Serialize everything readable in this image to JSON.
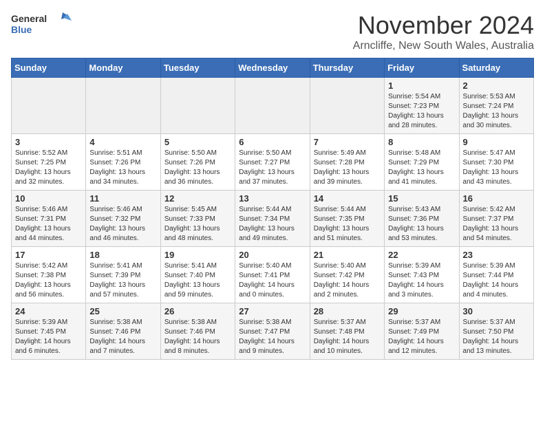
{
  "header": {
    "logo_general": "General",
    "logo_blue": "Blue",
    "month": "November 2024",
    "location": "Arncliffe, New South Wales, Australia"
  },
  "days_of_week": [
    "Sunday",
    "Monday",
    "Tuesday",
    "Wednesday",
    "Thursday",
    "Friday",
    "Saturday"
  ],
  "weeks": [
    [
      {
        "day": "",
        "empty": true
      },
      {
        "day": "",
        "empty": true
      },
      {
        "day": "",
        "empty": true
      },
      {
        "day": "",
        "empty": true
      },
      {
        "day": "",
        "empty": true
      },
      {
        "day": "1",
        "sunrise": "5:54 AM",
        "sunset": "7:23 PM",
        "daylight": "13 hours and 28 minutes."
      },
      {
        "day": "2",
        "sunrise": "5:53 AM",
        "sunset": "7:24 PM",
        "daylight": "13 hours and 30 minutes."
      }
    ],
    [
      {
        "day": "3",
        "sunrise": "5:52 AM",
        "sunset": "7:25 PM",
        "daylight": "13 hours and 32 minutes."
      },
      {
        "day": "4",
        "sunrise": "5:51 AM",
        "sunset": "7:26 PM",
        "daylight": "13 hours and 34 minutes."
      },
      {
        "day": "5",
        "sunrise": "5:50 AM",
        "sunset": "7:26 PM",
        "daylight": "13 hours and 36 minutes."
      },
      {
        "day": "6",
        "sunrise": "5:50 AM",
        "sunset": "7:27 PM",
        "daylight": "13 hours and 37 minutes."
      },
      {
        "day": "7",
        "sunrise": "5:49 AM",
        "sunset": "7:28 PM",
        "daylight": "13 hours and 39 minutes."
      },
      {
        "day": "8",
        "sunrise": "5:48 AM",
        "sunset": "7:29 PM",
        "daylight": "13 hours and 41 minutes."
      },
      {
        "day": "9",
        "sunrise": "5:47 AM",
        "sunset": "7:30 PM",
        "daylight": "13 hours and 43 minutes."
      }
    ],
    [
      {
        "day": "10",
        "sunrise": "5:46 AM",
        "sunset": "7:31 PM",
        "daylight": "13 hours and 44 minutes."
      },
      {
        "day": "11",
        "sunrise": "5:46 AM",
        "sunset": "7:32 PM",
        "daylight": "13 hours and 46 minutes."
      },
      {
        "day": "12",
        "sunrise": "5:45 AM",
        "sunset": "7:33 PM",
        "daylight": "13 hours and 48 minutes."
      },
      {
        "day": "13",
        "sunrise": "5:44 AM",
        "sunset": "7:34 PM",
        "daylight": "13 hours and 49 minutes."
      },
      {
        "day": "14",
        "sunrise": "5:44 AM",
        "sunset": "7:35 PM",
        "daylight": "13 hours and 51 minutes."
      },
      {
        "day": "15",
        "sunrise": "5:43 AM",
        "sunset": "7:36 PM",
        "daylight": "13 hours and 53 minutes."
      },
      {
        "day": "16",
        "sunrise": "5:42 AM",
        "sunset": "7:37 PM",
        "daylight": "13 hours and 54 minutes."
      }
    ],
    [
      {
        "day": "17",
        "sunrise": "5:42 AM",
        "sunset": "7:38 PM",
        "daylight": "13 hours and 56 minutes."
      },
      {
        "day": "18",
        "sunrise": "5:41 AM",
        "sunset": "7:39 PM",
        "daylight": "13 hours and 57 minutes."
      },
      {
        "day": "19",
        "sunrise": "5:41 AM",
        "sunset": "7:40 PM",
        "daylight": "13 hours and 59 minutes."
      },
      {
        "day": "20",
        "sunrise": "5:40 AM",
        "sunset": "7:41 PM",
        "daylight": "14 hours and 0 minutes."
      },
      {
        "day": "21",
        "sunrise": "5:40 AM",
        "sunset": "7:42 PM",
        "daylight": "14 hours and 2 minutes."
      },
      {
        "day": "22",
        "sunrise": "5:39 AM",
        "sunset": "7:43 PM",
        "daylight": "14 hours and 3 minutes."
      },
      {
        "day": "23",
        "sunrise": "5:39 AM",
        "sunset": "7:44 PM",
        "daylight": "14 hours and 4 minutes."
      }
    ],
    [
      {
        "day": "24",
        "sunrise": "5:39 AM",
        "sunset": "7:45 PM",
        "daylight": "14 hours and 6 minutes."
      },
      {
        "day": "25",
        "sunrise": "5:38 AM",
        "sunset": "7:46 PM",
        "daylight": "14 hours and 7 minutes."
      },
      {
        "day": "26",
        "sunrise": "5:38 AM",
        "sunset": "7:46 PM",
        "daylight": "14 hours and 8 minutes."
      },
      {
        "day": "27",
        "sunrise": "5:38 AM",
        "sunset": "7:47 PM",
        "daylight": "14 hours and 9 minutes."
      },
      {
        "day": "28",
        "sunrise": "5:37 AM",
        "sunset": "7:48 PM",
        "daylight": "14 hours and 10 minutes."
      },
      {
        "day": "29",
        "sunrise": "5:37 AM",
        "sunset": "7:49 PM",
        "daylight": "14 hours and 12 minutes."
      },
      {
        "day": "30",
        "sunrise": "5:37 AM",
        "sunset": "7:50 PM",
        "daylight": "14 hours and 13 minutes."
      }
    ]
  ]
}
